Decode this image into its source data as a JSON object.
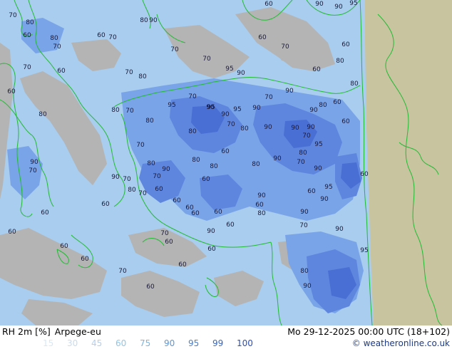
{
  "header": {
    "variable": "RH 2m [%]",
    "model": "Arpege-eu",
    "datetime": "Mo 29-12-2025 00:00 UTC (18+102)"
  },
  "legend": {
    "levels": [
      {
        "value": "15",
        "color": "#d8e8f6"
      },
      {
        "value": "30",
        "color": "#c6dcf2"
      },
      {
        "value": "45",
        "color": "#b3cfee"
      },
      {
        "value": "60",
        "color": "#8fc6ea"
      },
      {
        "value": "75",
        "color": "#78b4e4"
      },
      {
        "value": "90",
        "color": "#5a98dc"
      },
      {
        "value": "95",
        "color": "#4a7ed2"
      },
      {
        "value": "99",
        "color": "#3466c8"
      },
      {
        "value": "100",
        "color": "#2a4eb8"
      }
    ]
  },
  "credit": {
    "icon": "copyright-icon",
    "text": "© weatheronline.co.uk"
  },
  "map": {
    "colors": {
      "low_rh_gray": "#b4b4b4",
      "rh_60": "#a8cdee",
      "rh_70": "#8cb8ec",
      "rh_80": "#7aa4e8",
      "rh_90": "#5f86de",
      "rh_95": "#4a6fd4",
      "outside_domain": "#c8c4a0",
      "coastline": "#22bb33"
    },
    "contour_labels": [
      {
        "text": "70"
      },
      {
        "text": "80"
      },
      {
        "text": "60"
      },
      {
        "text": "80"
      },
      {
        "text": "70"
      },
      {
        "text": "60"
      },
      {
        "text": "70"
      },
      {
        "text": "80"
      },
      {
        "text": "90"
      },
      {
        "text": "60"
      },
      {
        "text": "90"
      },
      {
        "text": "90"
      },
      {
        "text": "95"
      },
      {
        "text": "60"
      },
      {
        "text": "70"
      },
      {
        "text": "70"
      },
      {
        "text": "70"
      },
      {
        "text": "60"
      },
      {
        "text": "60"
      },
      {
        "text": "80"
      },
      {
        "text": "70"
      },
      {
        "text": "60"
      },
      {
        "text": "70"
      },
      {
        "text": "80"
      },
      {
        "text": "90"
      },
      {
        "text": "95"
      },
      {
        "text": "70"
      },
      {
        "text": "60"
      },
      {
        "text": "80"
      },
      {
        "text": "70"
      },
      {
        "text": "90"
      },
      {
        "text": "95"
      },
      {
        "text": "90"
      },
      {
        "text": "80"
      },
      {
        "text": "60"
      },
      {
        "text": "80"
      },
      {
        "text": "80"
      },
      {
        "text": "70"
      },
      {
        "text": "80"
      },
      {
        "text": "90"
      },
      {
        "text": "95"
      },
      {
        "text": "90"
      },
      {
        "text": "90"
      },
      {
        "text": "95"
      },
      {
        "text": "60"
      },
      {
        "text": "70"
      },
      {
        "text": "80"
      },
      {
        "text": "90"
      },
      {
        "text": "80"
      },
      {
        "text": "90"
      },
      {
        "text": "90"
      },
      {
        "text": "70"
      },
      {
        "text": "70"
      },
      {
        "text": "60"
      },
      {
        "text": "80"
      },
      {
        "text": "90"
      },
      {
        "text": "70"
      },
      {
        "text": "90"
      },
      {
        "text": "80"
      },
      {
        "text": "90"
      },
      {
        "text": "95"
      },
      {
        "text": "80"
      },
      {
        "text": "70"
      },
      {
        "text": "90"
      },
      {
        "text": "70"
      },
      {
        "text": "70"
      },
      {
        "text": "80"
      },
      {
        "text": "90"
      },
      {
        "text": "60"
      },
      {
        "text": "60"
      },
      {
        "text": "80"
      },
      {
        "text": "80"
      },
      {
        "text": "70"
      },
      {
        "text": "60"
      },
      {
        "text": "60"
      },
      {
        "text": "90"
      },
      {
        "text": "95"
      },
      {
        "text": "60"
      },
      {
        "text": "90"
      },
      {
        "text": "60"
      },
      {
        "text": "60"
      },
      {
        "text": "60"
      },
      {
        "text": "60"
      },
      {
        "text": "60"
      },
      {
        "text": "80"
      },
      {
        "text": "90"
      },
      {
        "text": "60"
      },
      {
        "text": "90"
      },
      {
        "text": "60"
      },
      {
        "text": "60"
      },
      {
        "text": "60"
      },
      {
        "text": "70"
      },
      {
        "text": "90"
      },
      {
        "text": "70"
      },
      {
        "text": "60"
      },
      {
        "text": "60"
      },
      {
        "text": "60"
      },
      {
        "text": "70"
      },
      {
        "text": "60"
      },
      {
        "text": "60"
      },
      {
        "text": "80"
      },
      {
        "text": "90"
      },
      {
        "text": "95"
      }
    ]
  }
}
